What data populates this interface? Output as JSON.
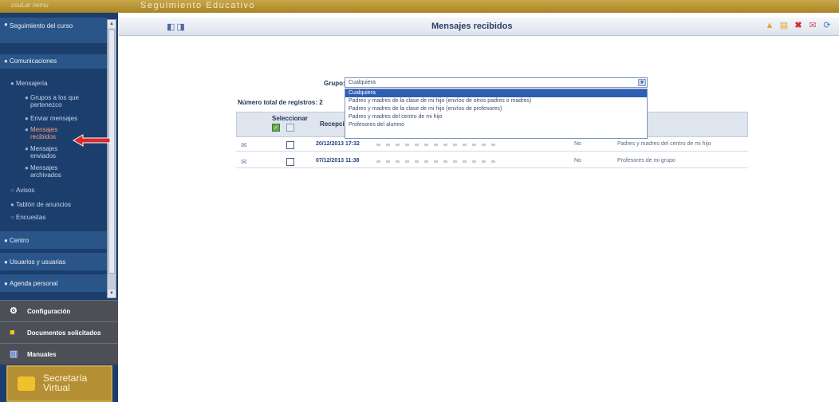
{
  "topbar": {
    "user": "usuLar nemu",
    "app_title": "Seguimiento Educativo"
  },
  "sidebar": {
    "sections": [
      {
        "label": "Seguimiento del curso"
      },
      {
        "label": "Comunicaciones"
      },
      {
        "label": "Centro"
      },
      {
        "label": "Usuarios y usuarias"
      },
      {
        "label": "Agenda personal"
      }
    ],
    "subitems": {
      "mensajeria": "Mensajería",
      "grupos": "Grupos a los que pertenezco",
      "enviar": "Enviar mensajes",
      "recibidos": "Mensajes recibidos",
      "enviados": "Mensajes enviados",
      "archivados": "Mensajes archivados",
      "avisos": "Avisos",
      "tablon": "Tablón de anuncios",
      "encuestas": "Encuestas"
    },
    "bottom": {
      "configuracion": "Configuración",
      "documentos": "Documentos solicitados",
      "manuales": "Manuales",
      "secretaria_line1": "Secretaría",
      "secretaria_line2": "Virtual"
    }
  },
  "header": {
    "title": "Mensajes recibidos"
  },
  "filter": {
    "label": "Grupo:",
    "selected": "Cualquiera",
    "options": [
      "Cualquiera",
      "Padres y madres de la clase de mi hijo (envíos de otros padres o madres)",
      "Padres y madres de la clase de mi hijo (envíos de profesores)",
      "Padres y madres del centro de mi hijo",
      "Profesores del alumno"
    ]
  },
  "table": {
    "total_label": "Número total de registros: 2",
    "col_select": "Seleccionar",
    "col_reception": "Recepción",
    "rows": [
      {
        "date": "20/12/2013 17:32",
        "read": "No",
        "group": "Padres y madres del centro de mi hijo"
      },
      {
        "date": "07/12/2013 11:38",
        "read": "No",
        "group": "Profesores de mi grupo"
      }
    ]
  },
  "colors": {
    "topbar": "#b08c2e",
    "sidebar": "#1b3e6d",
    "accent_red": "#d62b2b"
  }
}
